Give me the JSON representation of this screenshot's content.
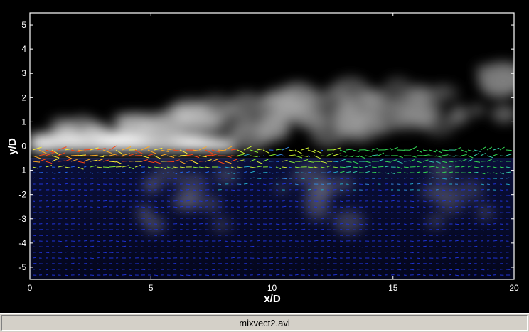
{
  "window": {
    "status_filename": "mixvect2.avi"
  },
  "plot": {
    "xlabel": "x/D",
    "ylabel": "y/D",
    "x_ticks": [
      "0",
      "5",
      "10",
      "15",
      "20"
    ],
    "y_ticks": [
      "5",
      "4",
      "3",
      "2",
      "1",
      "0",
      "1",
      "-2",
      "-3",
      "-4",
      "-5"
    ],
    "xlim": [
      0,
      20
    ],
    "ylim": [
      -5.5,
      5.5
    ]
  },
  "colors": {
    "background": "#000000",
    "axes": "#ffffff",
    "low_velocity": "#2233ee",
    "mid_velocity": "#33dd33",
    "high_velocity": "#ff5511",
    "status_bar": "#d4d0c8"
  }
}
